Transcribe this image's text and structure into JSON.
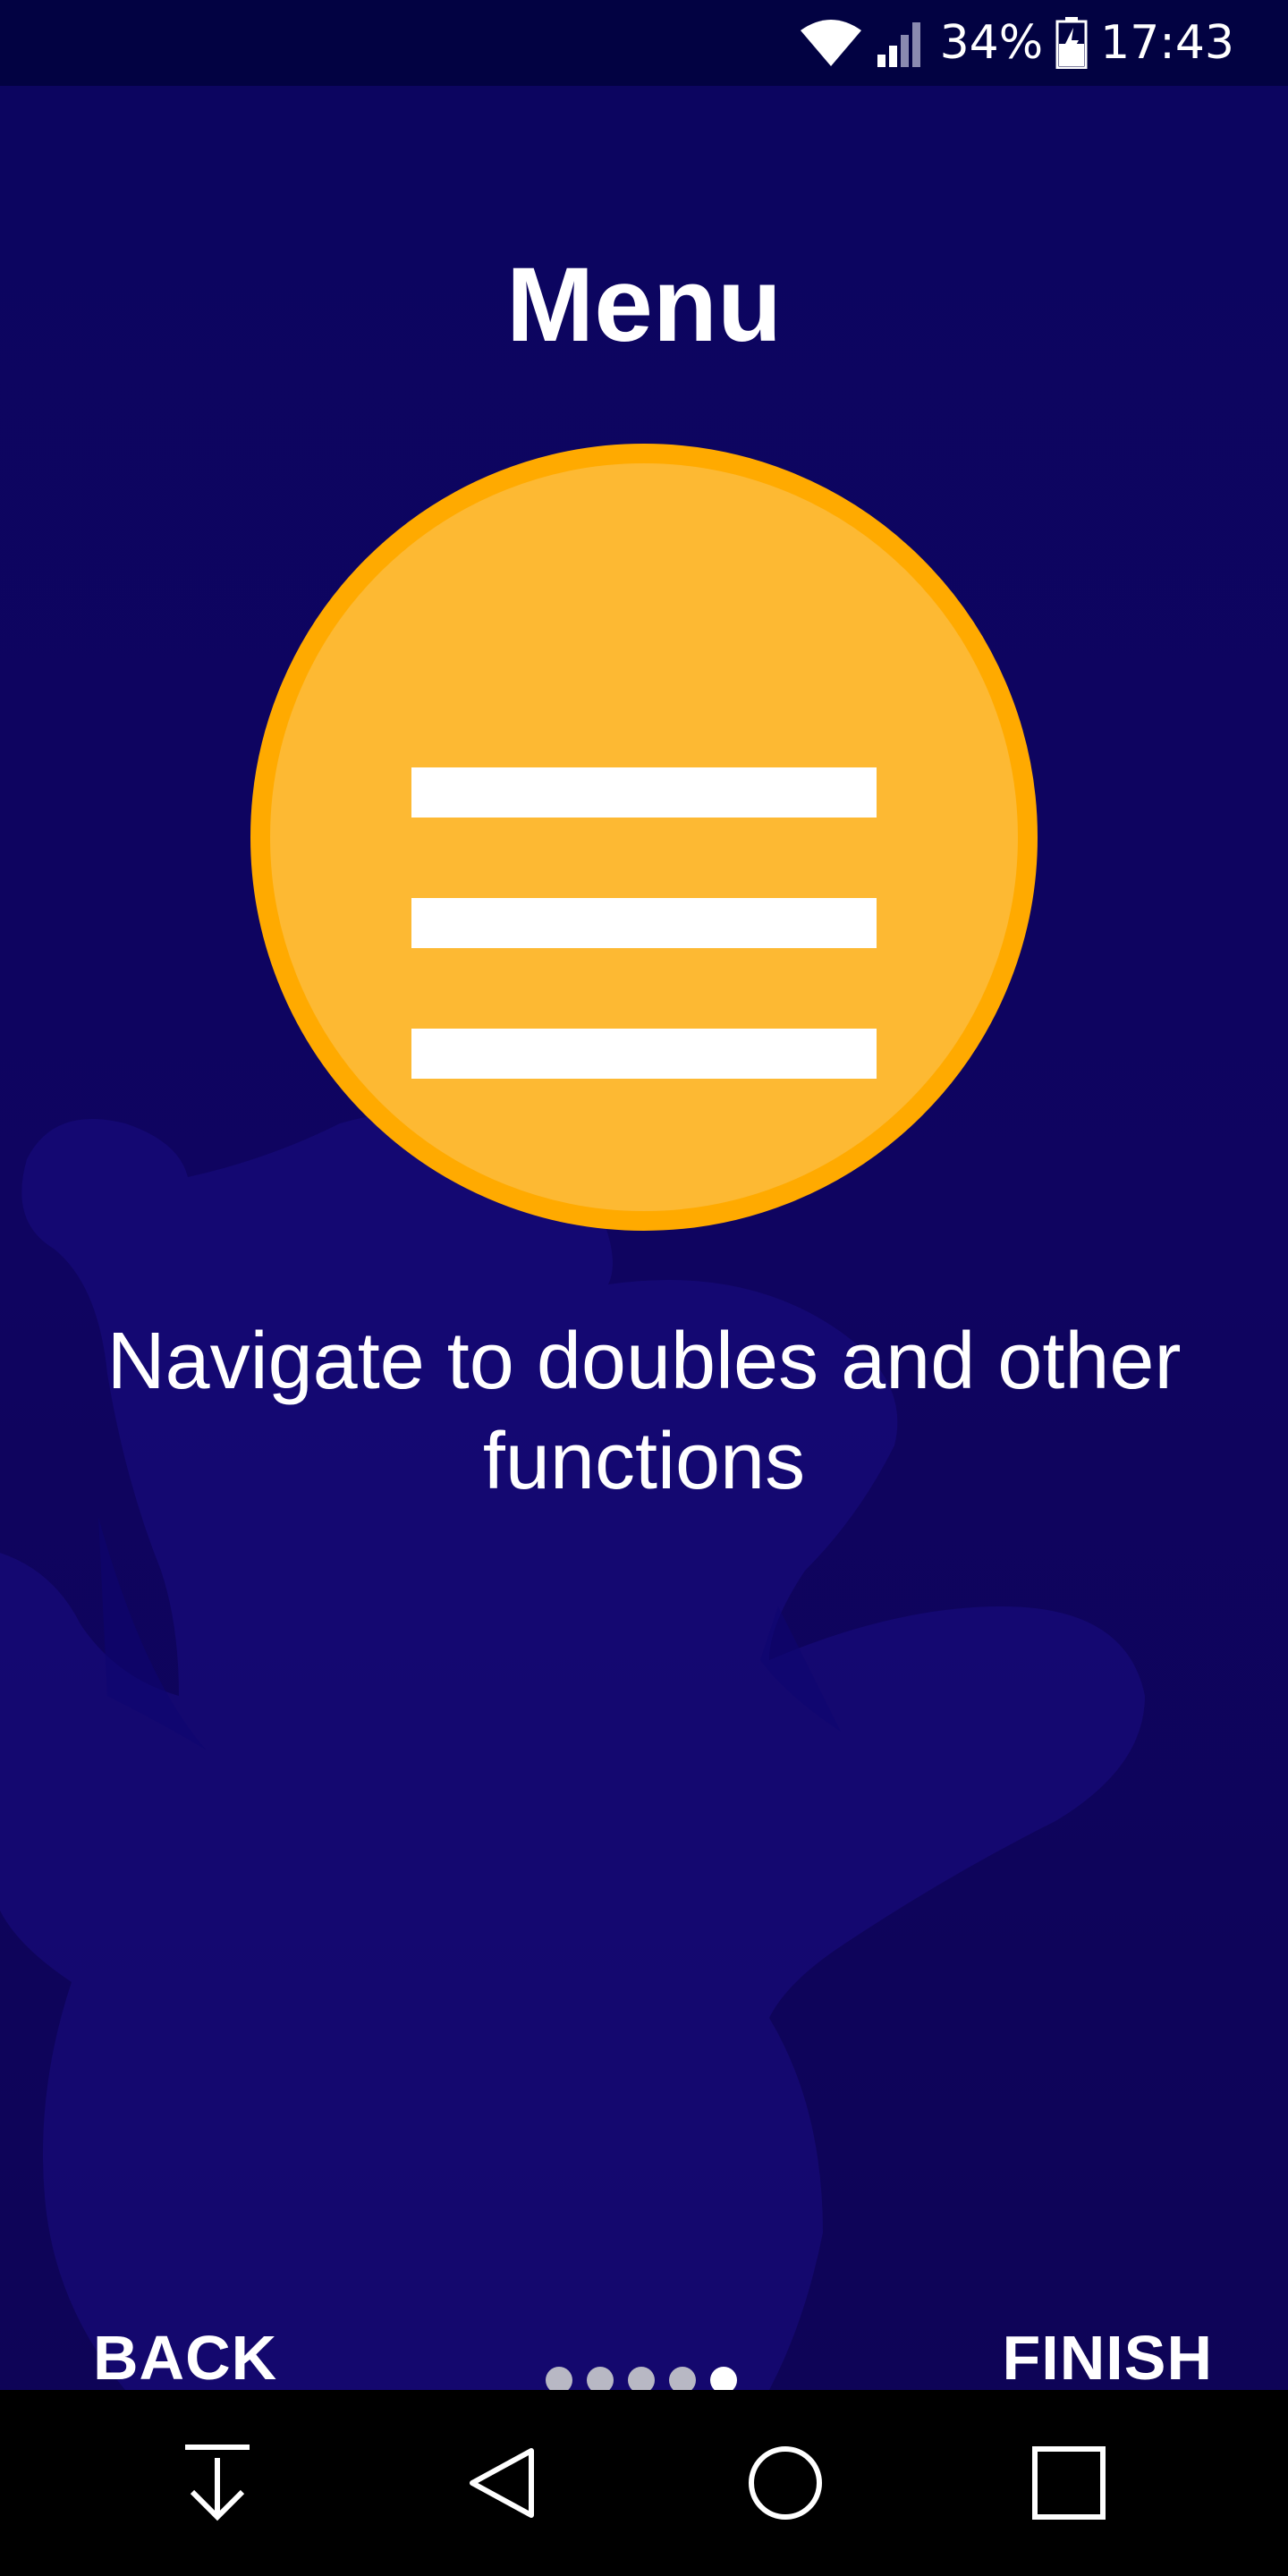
{
  "status_bar": {
    "wifi_icon": "wifi-icon",
    "signal_icon": "signal-icon",
    "battery_percent": "34%",
    "battery_icon": "battery-charging-icon",
    "time": "17:43"
  },
  "onboarding": {
    "title": "Menu",
    "icon": "hamburger-menu-icon",
    "description": "Navigate to doubles and other functions",
    "back_label": "BACK",
    "finish_label": "FINISH",
    "page_indicator": {
      "total_pages": 5,
      "current_page": 5
    }
  },
  "nav_bar": {
    "items": [
      "notifications-pull-icon",
      "back-triangle-icon",
      "home-circle-icon",
      "recents-square-icon"
    ]
  },
  "colors": {
    "status_bar_bg": "#020242",
    "background": "#0f0460",
    "circle_fill": "#fdb933",
    "circle_border": "#ffaa00",
    "text": "#ffffff",
    "dot_inactive": "#b8b8c4",
    "dot_active": "#ffffff"
  }
}
